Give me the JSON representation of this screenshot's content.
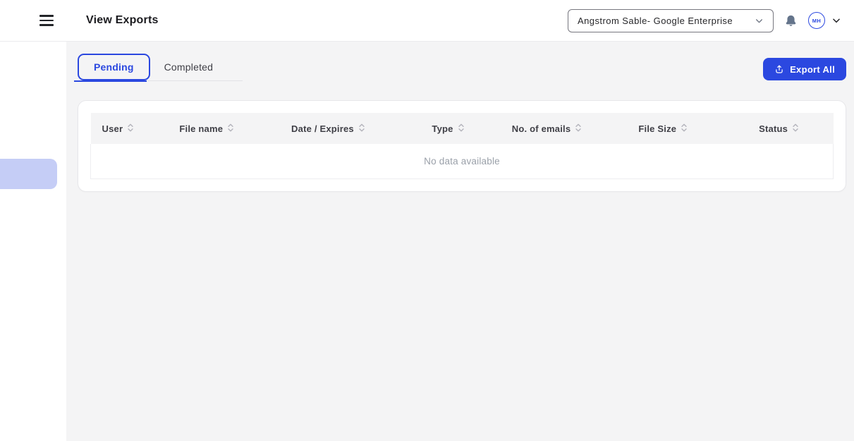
{
  "header": {
    "title": "View Exports",
    "org_selector": {
      "value": "Angstrom Sable- Google Enterprise"
    },
    "avatar": {
      "initials": "MH"
    }
  },
  "tabs": {
    "pending": {
      "label": "Pending",
      "active": true
    },
    "completed": {
      "label": "Completed",
      "active": false
    }
  },
  "actions": {
    "export_all": "Export All"
  },
  "table": {
    "columns": [
      "User",
      "File name",
      "Date / Expires",
      "Type",
      "No. of emails",
      "File Size",
      "Status"
    ],
    "rows": [],
    "empty_message": "No data available"
  },
  "icons": {
    "menu": "hamburger-menu ☰",
    "chevron_down": "⌄",
    "bell": "notification-bell 🔔",
    "avatar_chevron": "⌄",
    "upload": "export-upload ⤒",
    "sort": "column-sort ⇅"
  },
  "colors": {
    "primary": "#2b48e0",
    "page_bg": "#f4f4f5",
    "sidebar_highlight": "#c5cdf6",
    "table_header_bg": "#f4f4f5",
    "muted_text": "#9aa0a9"
  }
}
